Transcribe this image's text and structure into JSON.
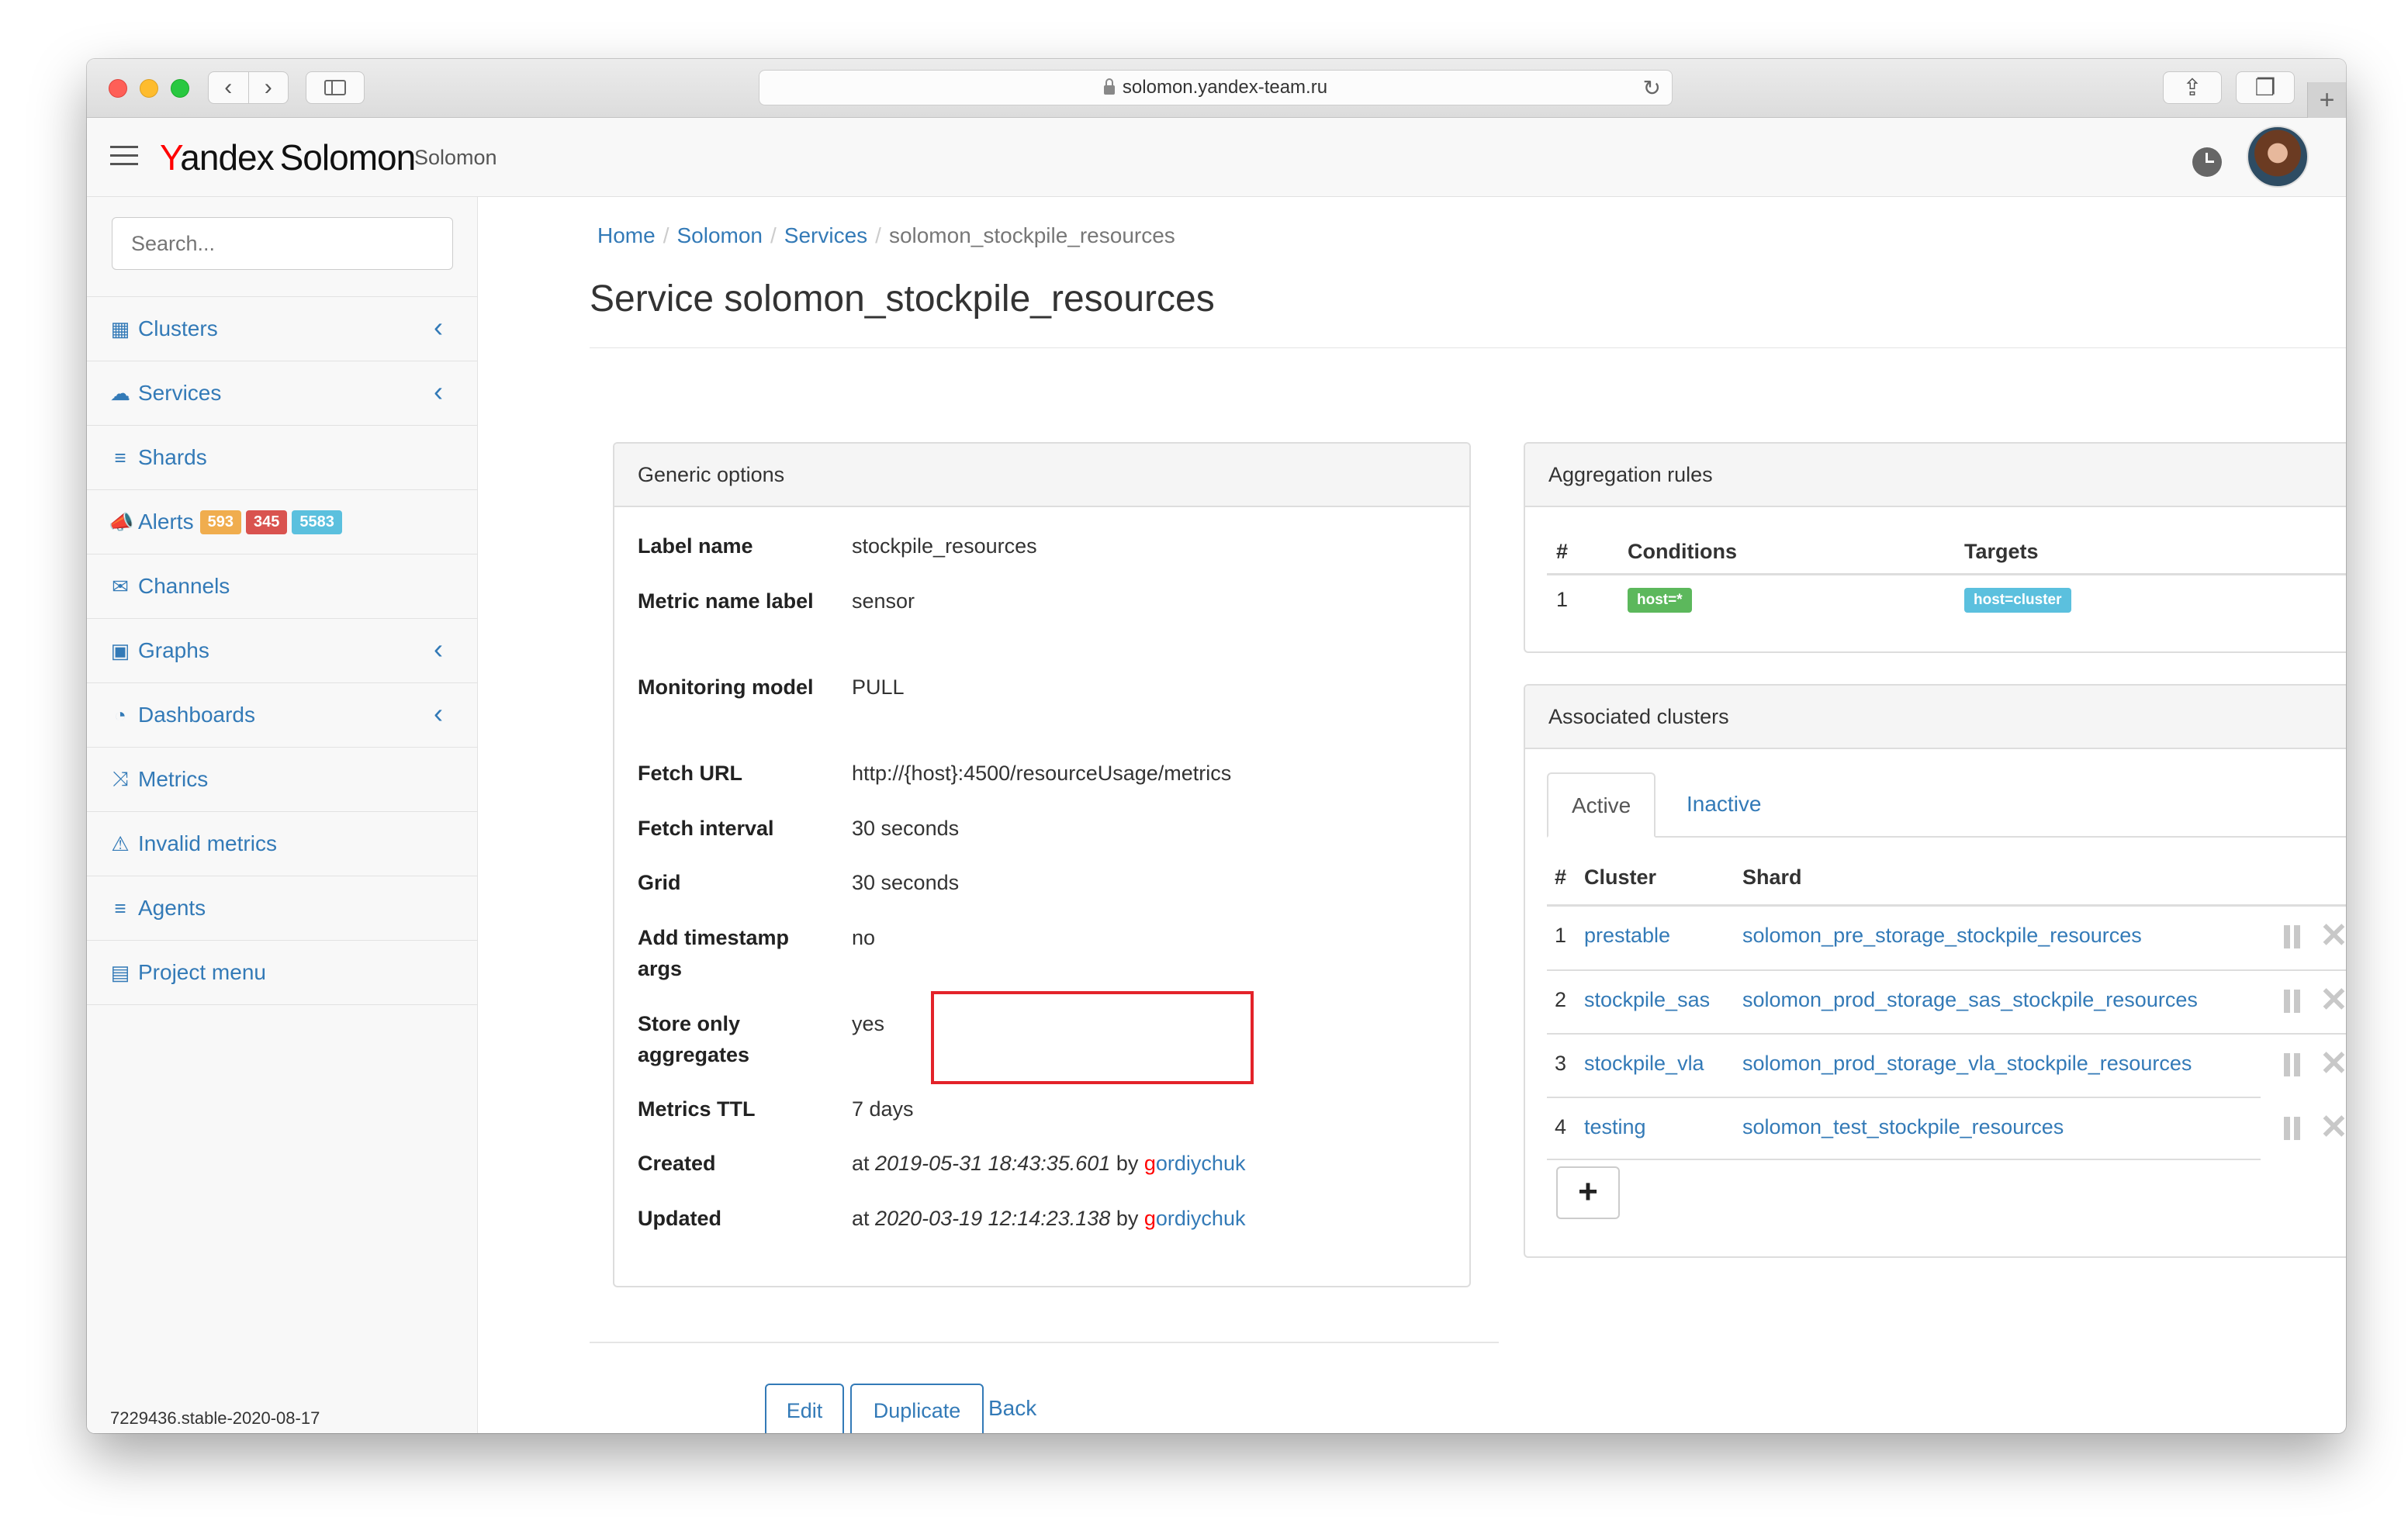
{
  "browser": {
    "url": "solomon.yandex-team.ru",
    "nav_back": "‹",
    "nav_forward": "›",
    "new_tab": "+"
  },
  "header": {
    "logo_y": "Y",
    "logo_andex": "andex",
    "logo_solomon": "Solomon",
    "project_name": "Solomon"
  },
  "sidebar": {
    "search_placeholder": "Search...",
    "items": [
      {
        "label": "Clusters",
        "icon": "▦",
        "chevron": true
      },
      {
        "label": "Services",
        "icon": "☁",
        "chevron": true
      },
      {
        "label": "Shards",
        "icon": "≡",
        "chevron": false
      },
      {
        "label": "Alerts",
        "icon": "📣",
        "chevron": false
      },
      {
        "label": "Channels",
        "icon": "✉",
        "chevron": false
      },
      {
        "label": "Graphs",
        "icon": "▣",
        "chevron": true
      },
      {
        "label": "Dashboards",
        "icon": "◔",
        "chevron": true
      },
      {
        "label": "Metrics",
        "icon": "⤨",
        "chevron": false
      },
      {
        "label": "Invalid metrics",
        "icon": "⚠",
        "chevron": false
      },
      {
        "label": "Agents",
        "icon": "≡",
        "chevron": false
      },
      {
        "label": "Project menu",
        "icon": "▤",
        "chevron": false
      }
    ],
    "alert_badges": [
      {
        "value": "593",
        "color": "#f0ad4e"
      },
      {
        "value": "345",
        "color": "#d9534f"
      },
      {
        "value": "5583",
        "color": "#5bc0de"
      }
    ],
    "version": "7229436.stable-2020-08-17"
  },
  "breadcrumb": {
    "home": "Home",
    "solomon": "Solomon",
    "services": "Services",
    "current": "solomon_stockpile_resources",
    "sep": "/"
  },
  "page_title": "Service solomon_stockpile_resources",
  "generic_options": {
    "title": "Generic options",
    "rows": [
      {
        "label": "Label name",
        "value": "stockpile_resources"
      },
      {
        "label": "Metric name label",
        "value": "sensor"
      },
      {
        "label": "Monitoring model",
        "value": "PULL"
      },
      {
        "label": "Fetch URL",
        "value": "http://{host}:4500/resourceUsage/metrics"
      },
      {
        "label": "Fetch interval",
        "value": "30 seconds"
      },
      {
        "label": "Grid",
        "value": "30 seconds"
      },
      {
        "label": "Add timestamp args",
        "value": "no"
      },
      {
        "label": "Store only aggregates",
        "value": "yes"
      },
      {
        "label": "Metrics TTL",
        "value": "7 days"
      }
    ],
    "created": {
      "label": "Created",
      "prefix": "at",
      "timestamp": "2019-05-31 18:43:35.601",
      "by": "by",
      "user_first": "g",
      "user_rest": "ordiychuk"
    },
    "updated": {
      "label": "Updated",
      "prefix": "at",
      "timestamp": "2020-03-19 12:14:23.138",
      "by": "by",
      "user_first": "g",
      "user_rest": "ordiychuk"
    }
  },
  "aggregation_rules": {
    "title": "Aggregation rules",
    "headers": [
      "#",
      "Conditions",
      "Targets"
    ],
    "rows": [
      {
        "num": "1",
        "condition": "host=*",
        "target": "host=cluster"
      }
    ],
    "condition_color": "#5cb85c",
    "target_color": "#5bc0de"
  },
  "associated_clusters": {
    "title": "Associated clusters",
    "tab_active": "Active",
    "tab_inactive": "Inactive",
    "headers": [
      "#",
      "Cluster",
      "Shard"
    ],
    "rows": [
      {
        "num": "1",
        "cluster": "prestable",
        "shard": "solomon_pre_storage_stockpile_resources"
      },
      {
        "num": "2",
        "cluster": "stockpile_sas",
        "shard": "solomon_prod_storage_sas_stockpile_resources"
      },
      {
        "num": "3",
        "cluster": "stockpile_vla",
        "shard": "solomon_prod_storage_vla_stockpile_resources"
      },
      {
        "num": "4",
        "cluster": "testing",
        "shard": "solomon_test_stockpile_resources"
      }
    ],
    "add_label": "+",
    "remove_glyph": "✕"
  },
  "actions": {
    "edit": "Edit",
    "duplicate": "Duplicate",
    "back": "Back"
  },
  "colors": {
    "link": "#337ab7",
    "highlight": "#e3232a"
  }
}
